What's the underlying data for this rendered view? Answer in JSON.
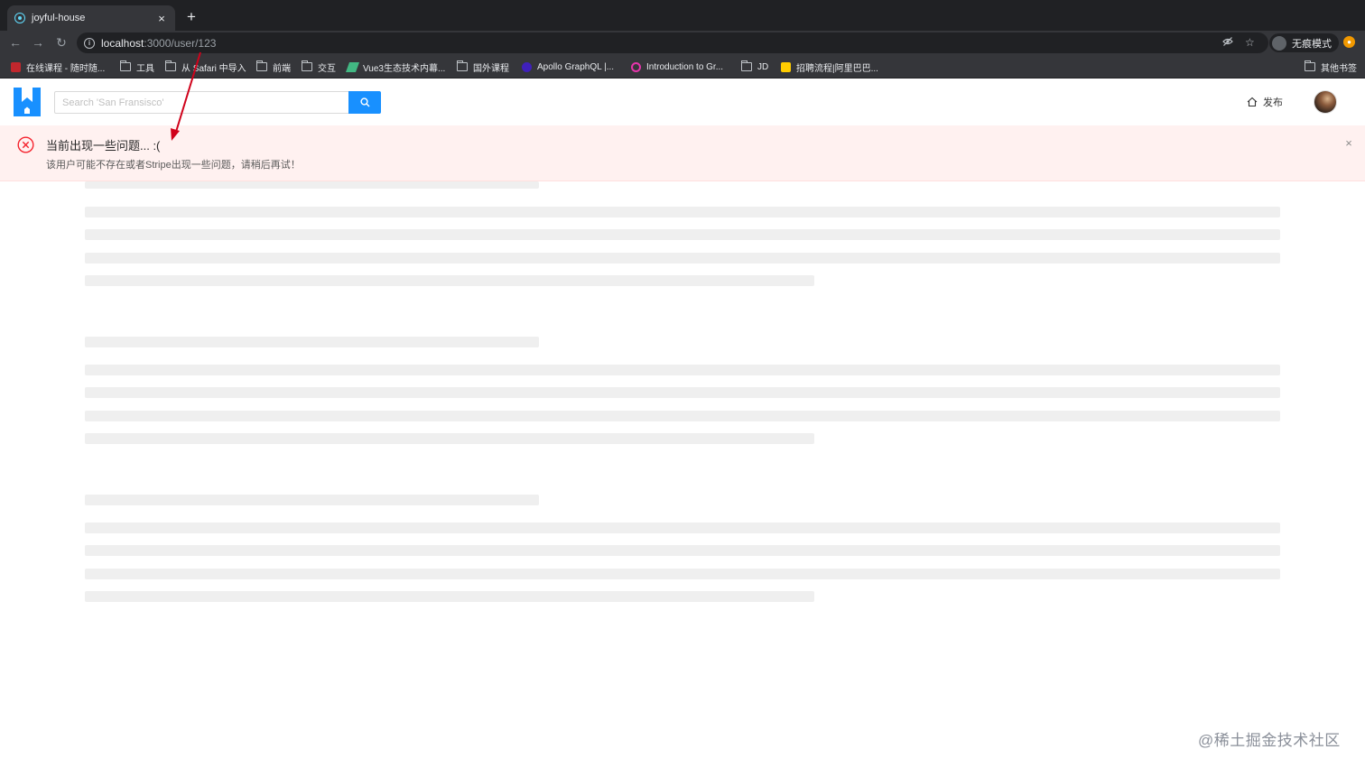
{
  "browser": {
    "tab_title": "joyful-house",
    "tab_close": "×",
    "new_tab": "+",
    "url_host": "localhost",
    "url_path": ":3000/user/123",
    "incognito_label": "无痕模式",
    "bookmarks": [
      {
        "label": "在线课程 - 随时随...",
        "icon": "red-logo-icon"
      },
      {
        "label": "工具",
        "icon": "folder-icon"
      },
      {
        "label": "从 Safari 中导入",
        "icon": "folder-icon"
      },
      {
        "label": "前端",
        "icon": "folder-icon"
      },
      {
        "label": "交互",
        "icon": "folder-icon"
      },
      {
        "label": "Vue3生态技术内幕...",
        "icon": "vue-icon"
      },
      {
        "label": "国外课程",
        "icon": "folder-icon"
      },
      {
        "label": "Apollo GraphQL |...",
        "icon": "apollo-icon"
      },
      {
        "label": "Introduction to Gr...",
        "icon": "graphql-icon"
      },
      {
        "label": "JD",
        "icon": "folder-icon"
      },
      {
        "label": "招聘流程|阿里巴巴...",
        "icon": "yellow-logo-icon"
      },
      {
        "label": "其他书签",
        "icon": "folder-icon"
      }
    ]
  },
  "header": {
    "search_placeholder": "Search 'San Fransisco'",
    "publish_label": "发布"
  },
  "alert": {
    "title": "当前出现一些问题... :(",
    "description": "该用户可能不存在或者Stripe出现一些问题，请稍后再试！",
    "close": "×"
  },
  "colors": {
    "primary": "#1890ff",
    "error": "#f5222d",
    "alert_bg": "#fff1f0",
    "annotation_arrow": "#d0021b"
  },
  "watermark": "@稀土掘金技术社区"
}
